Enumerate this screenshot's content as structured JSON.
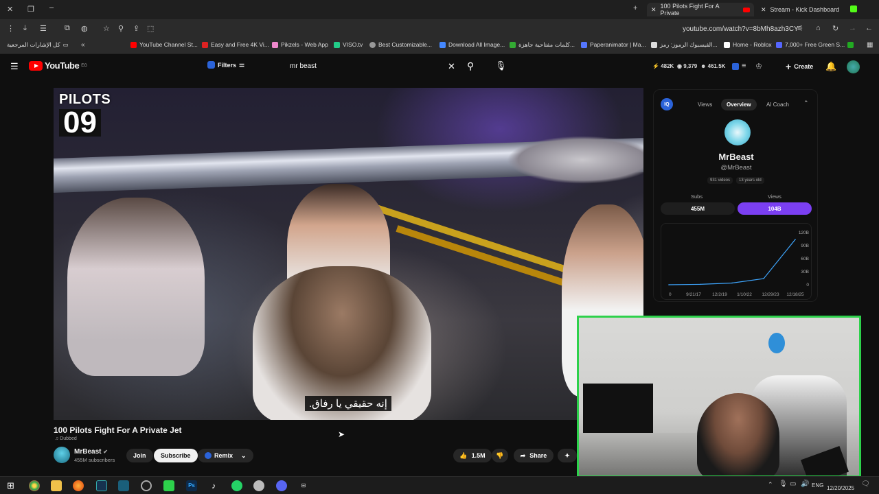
{
  "browser": {
    "tabs": [
      {
        "label": "100 Pilots Fight For A Private",
        "active": true
      },
      {
        "label": "Stream - Kick Dashboard",
        "active": false
      }
    ],
    "address": "youtube.com/watch?v=8bMh8azh3CY",
    "bookmarks": [
      "كل الإشارات المرجعية",
      "YouTube Channel St...",
      "Easy and Free 4K Vi...",
      "Pikzels - Web App",
      "VISO.tv",
      "Best Customizable...",
      "Download All Image...",
      "كلمات مفتاحية جاهزة...",
      "Paperanimator | Ma...",
      "الفيسبوك الرموز: رمز...",
      "Home - Roblox",
      "7,000+ Free Green S..."
    ]
  },
  "youtube": {
    "logo": "YouTube",
    "region": "EG",
    "filters_label": "Filters",
    "search_query": "mr beast",
    "header_stats": [
      "482K",
      "9,379",
      "461.5K"
    ],
    "create_label": "Create"
  },
  "video": {
    "badge_top": "PILOTS",
    "badge_num": "09",
    "subtitle": "إنه حقيقي يا رفاق.",
    "title": "100 Pilots Fight For A Private Jet",
    "dubbed": "Dubbed",
    "channel": "MrBeast",
    "channel_subs": "455M subscribers",
    "join_label": "Join",
    "subscribe_label": "Subscribe",
    "remix_label": "Remix",
    "likes": "1.5M",
    "share_label": "Share"
  },
  "panel": {
    "tabs": [
      "Views",
      "Overview",
      "AI Coach"
    ],
    "active_tab": "Overview",
    "name": "MrBeast",
    "handle": "@MrBeast",
    "chips": [
      "931 videos",
      "13 years old"
    ],
    "subs_label": "Subs",
    "subs_value": "455M",
    "views_label": "Views",
    "views_value": "104B"
  },
  "chart_data": {
    "type": "line",
    "x": [
      "9/21/17",
      "12/2/19",
      "1/10/22",
      "12/29/23",
      "12/18/25"
    ],
    "y_ticks": [
      "0",
      "30B",
      "60B",
      "90B",
      "120B"
    ],
    "x_start_label": "0",
    "ylim": [
      0,
      120
    ],
    "series": [
      {
        "values": [
          0,
          1,
          4,
          14,
          104
        ]
      }
    ],
    "line_color": "#3ea6ff"
  },
  "taskbar": {
    "lang": "ENG",
    "date": "12/20/2025"
  }
}
